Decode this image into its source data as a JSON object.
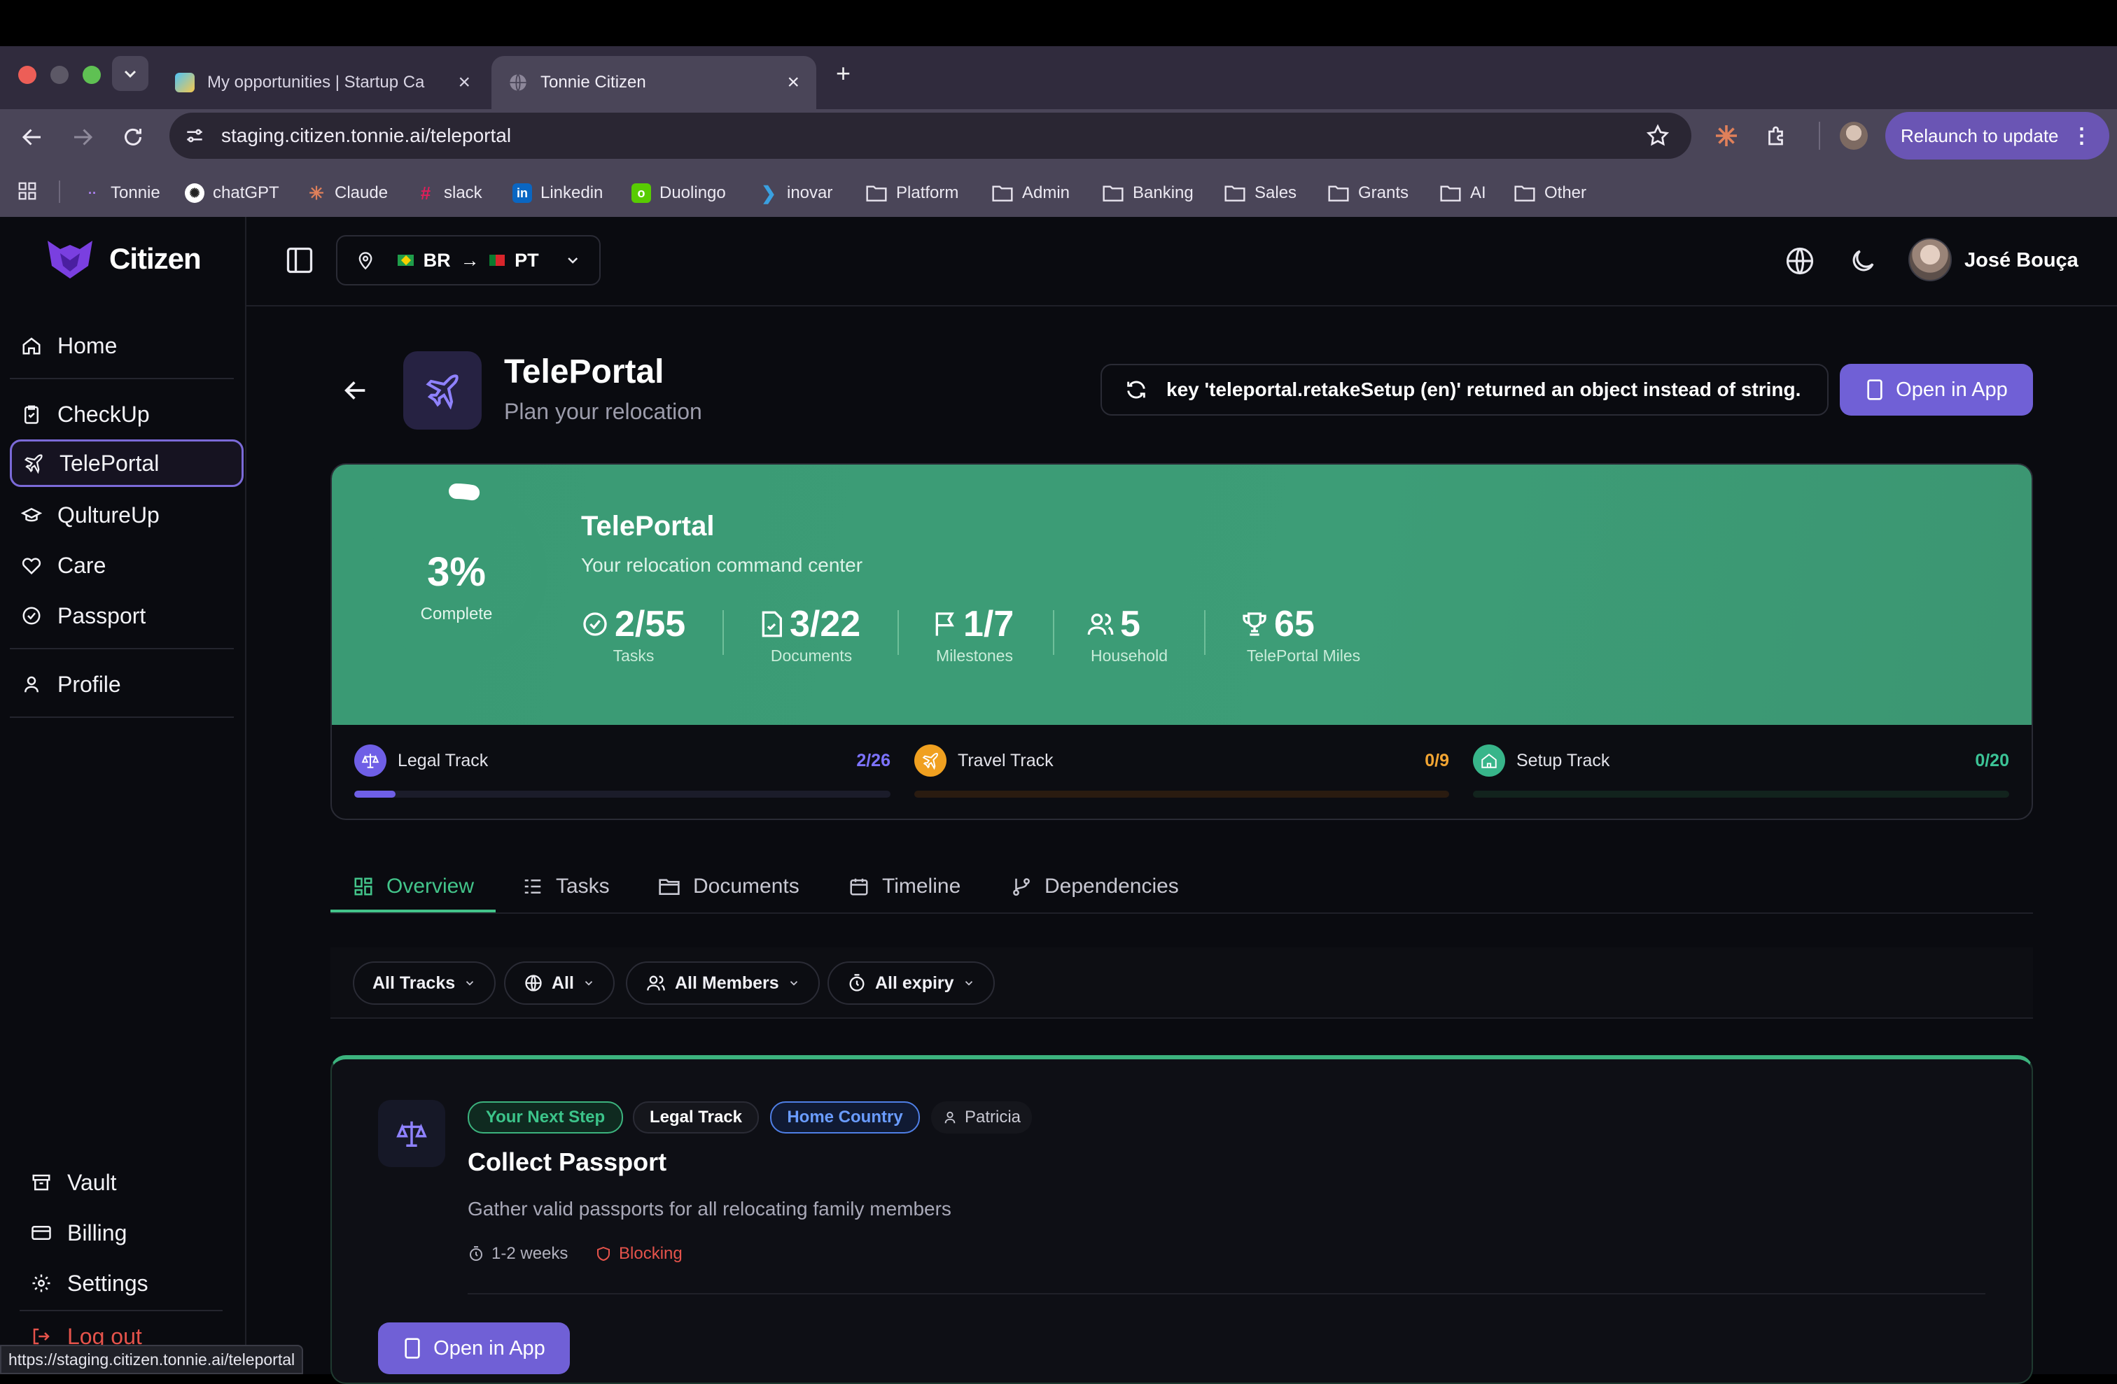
{
  "browser": {
    "tabs": [
      {
        "title": "My opportunities | Startup Ca"
      },
      {
        "title": "Tonnie Citizen"
      }
    ],
    "url": "staging.citizen.tonnie.ai/teleportal",
    "relaunch_label": "Relaunch to update",
    "bookmarks": [
      "Tonnie",
      "chatGPT",
      "Claude",
      "slack",
      "Linkedin",
      "Duolingo",
      "inovar",
      "Platform",
      "Admin",
      "Banking",
      "Sales",
      "Grants",
      "AI",
      "Other"
    ],
    "status_url": "https://staging.citizen.tonnie.ai/teleportal"
  },
  "app": {
    "brand": "Citizen",
    "route": {
      "from": "BR",
      "to": "PT"
    },
    "user_name": "José Bouça",
    "nav_main": [
      "Home",
      "CheckUp",
      "TelePortal",
      "QultureUp",
      "Care",
      "Passport",
      "Profile"
    ],
    "nav_bottom": [
      "Vault",
      "Billing",
      "Settings",
      "Log out"
    ]
  },
  "page": {
    "title": "TelePortal",
    "subtitle": "Plan your relocation",
    "error_message": "key 'teleportal.retakeSetup (en)' returned an object instead of string.",
    "open_app_label": "Open in App"
  },
  "hero": {
    "percent": "3%",
    "percent_label": "Complete",
    "progress_fraction": 0.03,
    "title": "TelePortal",
    "subtitle": "Your relocation command center",
    "stats": [
      {
        "value": "2/55",
        "label": "Tasks",
        "icon": "check-circle-icon"
      },
      {
        "value": "3/22",
        "label": "Documents",
        "icon": "document-check-icon"
      },
      {
        "value": "1/7",
        "label": "Milestones",
        "icon": "flag-icon"
      },
      {
        "value": "5",
        "label": "Household",
        "icon": "users-icon"
      },
      {
        "value": "65",
        "label": "TelePortal Miles",
        "icon": "trophy-icon"
      }
    ]
  },
  "tracks": [
    {
      "label": "Legal Track",
      "value": "2/26",
      "fraction": 0.077,
      "color": "#6f5fe6",
      "text_color": "#7d73ff",
      "icon": "scale-icon"
    },
    {
      "label": "Travel Track",
      "value": "0/9",
      "fraction": 0,
      "color": "#f0a020",
      "text_color": "#f2a533",
      "icon": "plane-icon"
    },
    {
      "label": "Setup Track",
      "value": "0/20",
      "fraction": 0,
      "color": "#38b58a",
      "text_color": "#3cc396",
      "icon": "home-icon"
    }
  ],
  "tabs": [
    "Overview",
    "Tasks",
    "Documents",
    "Timeline",
    "Dependencies"
  ],
  "filters": [
    "All Tracks",
    "All",
    "All Members",
    "All expiry"
  ],
  "next_step": {
    "badges": [
      "Your Next Step",
      "Legal Track",
      "Home Country"
    ],
    "assignee": "Patricia",
    "title": "Collect Passport",
    "description": "Gather valid passports for all relocating family members",
    "duration": "1-2 weeks",
    "blocking_label": "Blocking",
    "open_app_label": "Open in App"
  },
  "colors": {
    "accent": "#7060d6",
    "hero_green": "#3f9b73",
    "tab_active": "#43c48a",
    "blocking": "#e5534b"
  }
}
